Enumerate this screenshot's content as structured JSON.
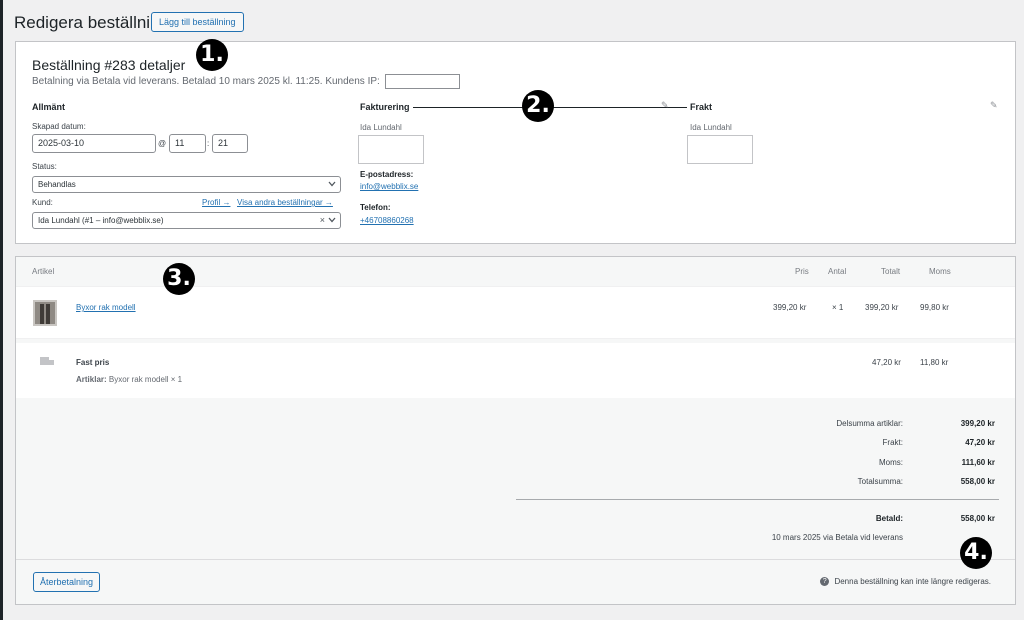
{
  "header": {
    "title": "Redigera beställning",
    "add_button": "Lägg till beställning"
  },
  "order": {
    "title": "Beställning #283 detaljer",
    "meta": "Betalning via Betala vid leverans. Betalad 10 mars 2025 kl. 11:25. Kundens IP:",
    "general": {
      "heading": "Allmänt",
      "created_label": "Skapad datum:",
      "date": "2025-03-10",
      "at": "@",
      "hour": "11",
      "sep": ":",
      "minute": "21",
      "status_label": "Status:",
      "status": "Behandlas",
      "customer_label": "Kund:",
      "profile_link": "Profil →",
      "other_orders_link": "Visa andra beställningar →",
      "customer": "Ida Lundahl (#1 – info@webblix.se)",
      "clear": "×"
    },
    "billing": {
      "heading": "Fakturering",
      "name": "Ida Lundahl",
      "email_label": "E-postadress:",
      "email": "info@webblix.se",
      "phone_label": "Telefon:",
      "phone": "+46708860268"
    },
    "shipping": {
      "heading": "Frakt",
      "name": "Ida Lundahl"
    }
  },
  "items": {
    "columns": {
      "article": "Artikel",
      "price": "Pris",
      "qty": "Antal",
      "total": "Totalt",
      "tax": "Moms"
    },
    "product": {
      "name": "Byxor rak modell",
      "price": "399,20 kr",
      "qty": "× 1",
      "total": "399,20 kr",
      "tax": "99,80 kr"
    },
    "shipping_line": {
      "name": "Fast pris",
      "items_label": "Artiklar:",
      "items_value": "Byxor rak modell × 1",
      "total": "47,20 kr",
      "tax": "11,80 kr"
    }
  },
  "totals": {
    "subtotal_label": "Delsumma artiklar:",
    "subtotal": "399,20 kr",
    "shipping_label": "Frakt:",
    "shipping": "47,20 kr",
    "tax_label": "Moms:",
    "tax": "111,60 kr",
    "total_label": "Totalsumma:",
    "total": "558,00 kr",
    "paid_label": "Betald:",
    "paid": "558,00 kr",
    "paid_note": "10 mars 2025 via Betala vid leverans"
  },
  "footer": {
    "refund_button": "Återbetalning",
    "note": "Denna beställning kan inte längre redigeras.",
    "info_glyph": "?"
  },
  "callouts": [
    "1.",
    "2.",
    "3.",
    "4."
  ],
  "colors": {
    "accent": "#2271b1",
    "border": "#c3c4c7",
    "background": "#f0f0f1"
  }
}
